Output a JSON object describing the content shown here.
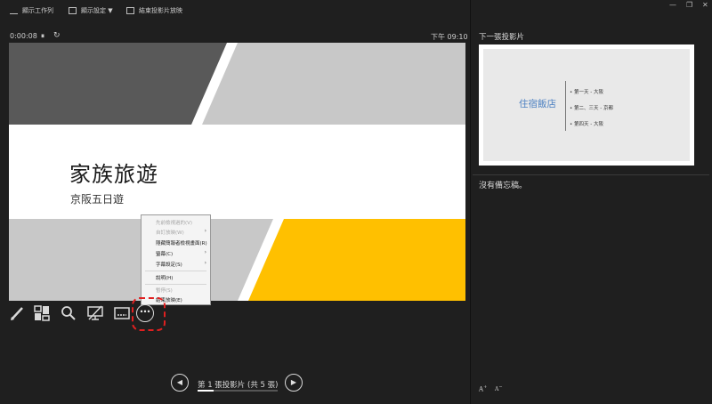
{
  "toolbar": {
    "show_taskbar": "顯示工作列",
    "display_settings": "顯示設定 ▼",
    "end_slideshow": "結束投影片放映"
  },
  "window_controls": {
    "minimize": "—",
    "restore": "❐"
  },
  "timer": {
    "elapsed": "0:00:08",
    "pause": "⏸",
    "reset": "↻",
    "clock": "下午 09:10"
  },
  "slide": {
    "title": "家族旅遊",
    "subtitle": "京阪五日遊",
    "colors": {
      "dark_gray": "#595959",
      "light_gray": "#c8c8c8",
      "yellow": "#ffc000"
    }
  },
  "context_menu": {
    "items": [
      {
        "label": "先前檢視過的(V)",
        "disabled": true,
        "submenu": false
      },
      {
        "label": "自訂放映(W)",
        "disabled": true,
        "submenu": true
      },
      {
        "label": "隱藏簡報者檢視畫面(R)",
        "disabled": false,
        "submenu": false
      },
      {
        "label": "螢幕(C)",
        "disabled": false,
        "submenu": true
      },
      {
        "label": "字幕設定(S)",
        "disabled": false,
        "submenu": true
      },
      {
        "label": "說明(H)",
        "disabled": false,
        "submenu": false
      },
      {
        "label": "暫停(S)",
        "disabled": true,
        "submenu": false
      },
      {
        "label": "結束放映(E)",
        "disabled": false,
        "submenu": false
      }
    ]
  },
  "tools": [
    {
      "name": "pen-icon"
    },
    {
      "name": "see-all-slides-icon"
    },
    {
      "name": "zoom-icon"
    },
    {
      "name": "black-screen-icon"
    },
    {
      "name": "subtitles-icon"
    },
    {
      "name": "more-options-icon"
    }
  ],
  "more_glyph": "⋯",
  "navigation": {
    "prev": "◀",
    "next": "▶",
    "counter": "第 1 張投影片 (共 5 張)",
    "progress": 0.2
  },
  "next_slide": {
    "label": "下一張投影片",
    "title": "住宿飯店",
    "bullets": [
      "第一天 - 大阪",
      "第二、三天 - 京都",
      "第四天 - 大阪"
    ]
  },
  "notes": {
    "text": "沒有備忘稿。",
    "increase_font": "A",
    "decrease_font": "A"
  }
}
